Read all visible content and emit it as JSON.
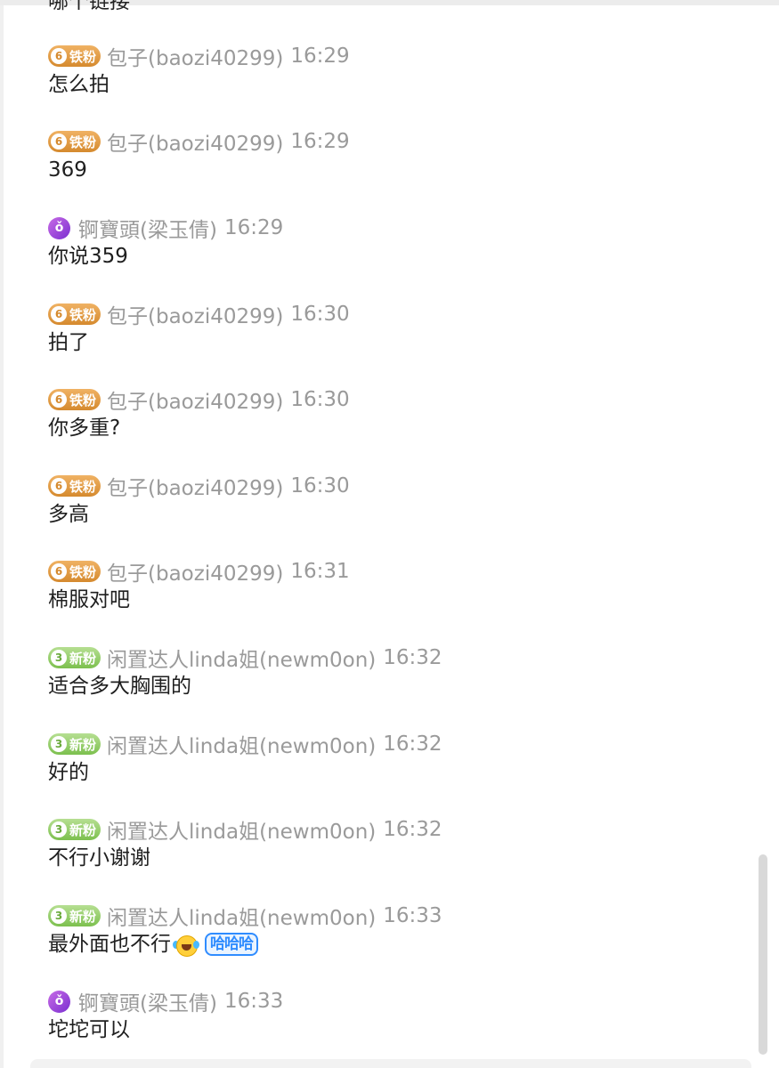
{
  "partial_top_text": "哪个链接",
  "badges": {
    "tie": {
      "level": "6",
      "label": "铁粉"
    },
    "xin": {
      "level": "3",
      "label": "新粉"
    }
  },
  "sticker_text": "哈哈哈",
  "colors": {
    "tie_badge": "#e1993f",
    "xin_badge": "#8fc963",
    "name_gray": "#9a9a9a",
    "text": "#1f1f1f",
    "avatar_purple": "#9a45dc"
  },
  "messages": [
    {
      "badge": "tie",
      "name": "包子(baozi40299)",
      "time": "16:29",
      "text": "怎么拍"
    },
    {
      "badge": "tie",
      "name": "包子(baozi40299)",
      "time": "16:29",
      "text": "369"
    },
    {
      "badge": "avatar",
      "name": "锕寶頭(梁玉倩)",
      "time": "16:29",
      "text": "你说359"
    },
    {
      "badge": "tie",
      "name": "包子(baozi40299)",
      "time": "16:30",
      "text": "拍了"
    },
    {
      "badge": "tie",
      "name": "包子(baozi40299)",
      "time": "16:30",
      "text": "你多重?"
    },
    {
      "badge": "tie",
      "name": "包子(baozi40299)",
      "time": "16:30",
      "text": "多高"
    },
    {
      "badge": "tie",
      "name": "包子(baozi40299)",
      "time": "16:31",
      "text": "棉服对吧"
    },
    {
      "badge": "xin",
      "name": "闲置达人linda姐(newm0on)",
      "time": "16:32",
      "text": "适合多大胸围的"
    },
    {
      "badge": "xin",
      "name": "闲置达人linda姐(newm0on)",
      "time": "16:32",
      "text": "好的"
    },
    {
      "badge": "xin",
      "name": "闲置达人linda姐(newm0on)",
      "time": "16:32",
      "text": "不行小谢谢"
    },
    {
      "badge": "xin",
      "name": "闲置达人linda姐(newm0on)",
      "time": "16:33",
      "text": "最外面也不行"
    },
    {
      "badge": "avatar",
      "name": "锕寶頭(梁玉倩)",
      "time": "16:33",
      "text": "坨坨可以"
    }
  ]
}
